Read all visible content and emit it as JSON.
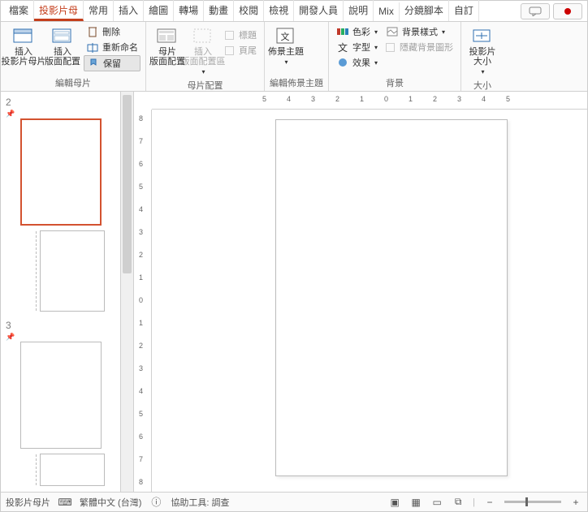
{
  "tabs": {
    "file": "檔案",
    "slidemaster": "投影片母",
    "home": "常用",
    "insert": "插入",
    "draw": "繪圖",
    "transition": "轉場",
    "animation": "動畫",
    "review": "校閱",
    "view": "檢視",
    "developer": "開發人員",
    "help": "說明",
    "mix": "Mix",
    "storyboard": "分鏡腳本",
    "custom": "自訂"
  },
  "ribbon": {
    "editMaster": {
      "insertSlideMaster": "插入\n投影片母片",
      "insertLayout": "插入\n版面配置",
      "delete": "刪除",
      "rename": "重新命名",
      "preserve": "保留",
      "group": "編輯母片"
    },
    "masterLayout": {
      "masterLayout": "母片\n版面配置",
      "insertPlaceholder": "插入\n版面配置區",
      "title": "標題",
      "footer": "頁尾",
      "group": "母片配置"
    },
    "editTheme": {
      "theme": "佈景主題",
      "group": "編輯佈景主題"
    },
    "background": {
      "colors": "色彩",
      "fonts": "字型",
      "effects": "效果",
      "bgStyles": "背景樣式",
      "hideBg": "隱藏背景圖形",
      "group": "背景"
    },
    "size": {
      "slideSize": "投影片\n大小",
      "group": "大小"
    }
  },
  "thumbs": {
    "n2": "2",
    "n3": "3"
  },
  "ruler": {
    "h": [
      "5",
      "4",
      "3",
      "2",
      "1",
      "0",
      "1",
      "2",
      "3",
      "4",
      "5"
    ],
    "v": [
      "8",
      "7",
      "6",
      "5",
      "4",
      "3",
      "2",
      "1",
      "0",
      "1",
      "2",
      "3",
      "4",
      "5",
      "6",
      "7",
      "8"
    ]
  },
  "status": {
    "view": "投影片母片",
    "lang": "繁體中文 (台灣)",
    "access": "協助工具: 調查"
  }
}
